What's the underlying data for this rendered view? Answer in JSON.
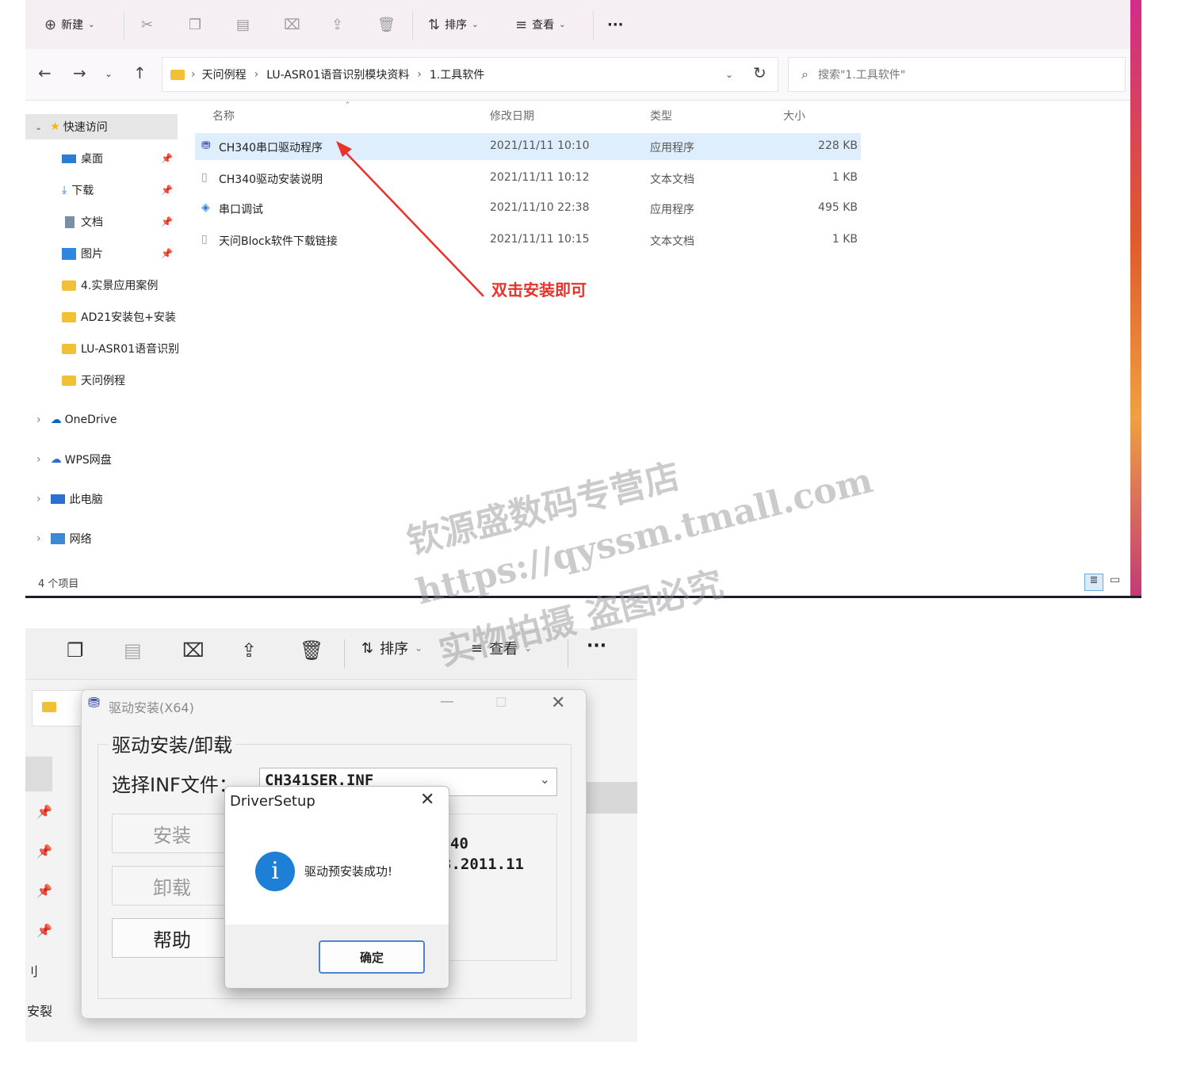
{
  "explorer": {
    "toolbar": {
      "new_label": "新建",
      "sort_label": "排序",
      "view_label": "查看",
      "more_label": "···"
    },
    "breadcrumb": [
      "天问例程",
      "LU-ASR01语音识别模块资料",
      "1.工具软件"
    ],
    "search_placeholder": "搜索\"1.工具软件\"",
    "nav": {
      "quick_access": "快速访问",
      "items": [
        "桌面",
        "下载",
        "文档",
        "图片",
        "4.实景应用案例",
        "AD21安装包+安装",
        "LU-ASR01语音识别",
        "天问例程"
      ],
      "roots": [
        "OneDrive",
        "WPS网盘",
        "此电脑",
        "网络"
      ]
    },
    "columns": [
      "名称",
      "修改日期",
      "类型",
      "大小"
    ],
    "files": [
      {
        "name": "CH340串口驱动程序",
        "date": "2021/11/11 10:10",
        "type": "应用程序",
        "size": "228 KB"
      },
      {
        "name": "CH340驱动安装说明",
        "date": "2021/11/11 10:12",
        "type": "文本文档",
        "size": "1 KB"
      },
      {
        "name": "串口调试",
        "date": "2021/11/10 22:38",
        "type": "应用程序",
        "size": "495 KB"
      },
      {
        "name": "天问Block软件下载链接",
        "date": "2021/11/11 10:15",
        "type": "文本文档",
        "size": "1 KB"
      }
    ],
    "annotation": "双击安装即可",
    "status": "4 个项目"
  },
  "lower": {
    "toolbar": {
      "sort_label": "排序",
      "view_label": "查看",
      "more_label": "···"
    },
    "side_fragments": [
      "刂",
      "安裂"
    ],
    "driver_dialog": {
      "title": "驱动安装(X64)",
      "group_label": "驱动安装/卸载",
      "inf_label": "选择INF文件：",
      "inf_value": "CH341SER.INF",
      "install_label": "安装",
      "uninstall_label": "卸载",
      "help_label": "帮助",
      "info_line1": "40",
      "info_line2": "3.2011.11"
    },
    "message_box": {
      "title": "DriverSetup",
      "message": "驱动预安装成功!",
      "ok_label": "确定"
    }
  },
  "watermark": {
    "line1": "钦源盛数码专营店",
    "line2": "https://qyssm.tmall.com",
    "line3": "实物拍摄 盗图必究"
  },
  "colors": {
    "annotation": "#e8322b",
    "selection": "#dfeefc",
    "info_icon": "#1e7fd6"
  }
}
